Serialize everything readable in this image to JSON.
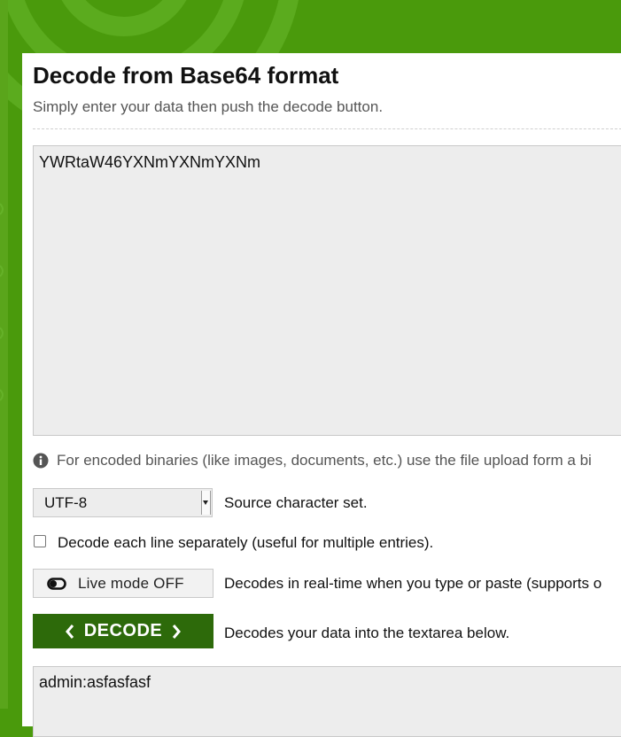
{
  "page": {
    "title": "Decode from Base64 format",
    "subtitle": "Simply enter your data then push the decode button."
  },
  "input": {
    "value": "YWRtaW46YXNmYXNmYXNm"
  },
  "info": {
    "icon": "info-icon",
    "text": "For encoded binaries (like images, documents, etc.) use the file upload form a bi"
  },
  "charset": {
    "selected": "UTF-8",
    "label": "Source character set."
  },
  "options": {
    "line_separately_label": "Decode each line separately (useful for multiple entries).",
    "line_separately_checked": false
  },
  "live_mode": {
    "icon": "toggle-off-icon",
    "button_label": "Live mode OFF",
    "description": "Decodes in real-time when you type or paste (supports o"
  },
  "decode": {
    "button_label": "DECODE",
    "description": "Decodes your data into the textarea below."
  },
  "output": {
    "value": "admin:asfasfasf"
  },
  "colors": {
    "brand_green": "#4a9a0c",
    "button_dark_green": "#2d6a0a",
    "field_bg": "#ededed"
  }
}
